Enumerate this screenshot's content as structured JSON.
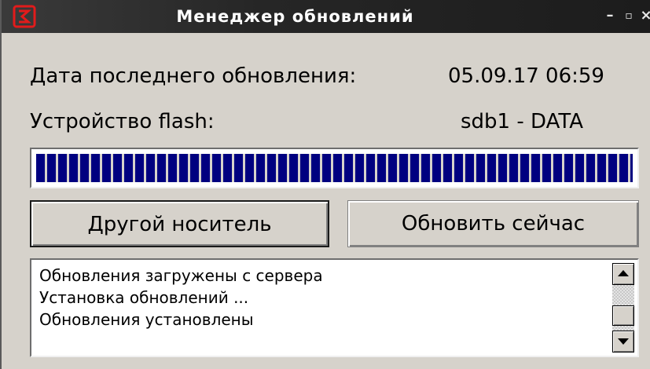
{
  "window": {
    "title": "Менеджер обновлений",
    "minimize_glyph": "–",
    "maximize_glyph": "▫",
    "close_glyph": "×",
    "icon": "app-logo-icon"
  },
  "info": {
    "last_update_label": "Дата последнего обновления:",
    "last_update_value": "05.09.17 06:59",
    "device_label": "Устройство flash:",
    "device_value": "sdb1 - DATA"
  },
  "progress": {
    "value_percent": 100,
    "fill_color": "#000080"
  },
  "buttons": {
    "other_media": "Другой носитель",
    "update_now": "Обновить сейчас"
  },
  "log": {
    "lines": [
      "Обновления загружены с сервера",
      "Установка обновлений ...",
      "Обновления установлены"
    ]
  },
  "colors": {
    "accent": "#e21b1b",
    "titlebar": "#262626",
    "background": "#d6d2cb"
  }
}
